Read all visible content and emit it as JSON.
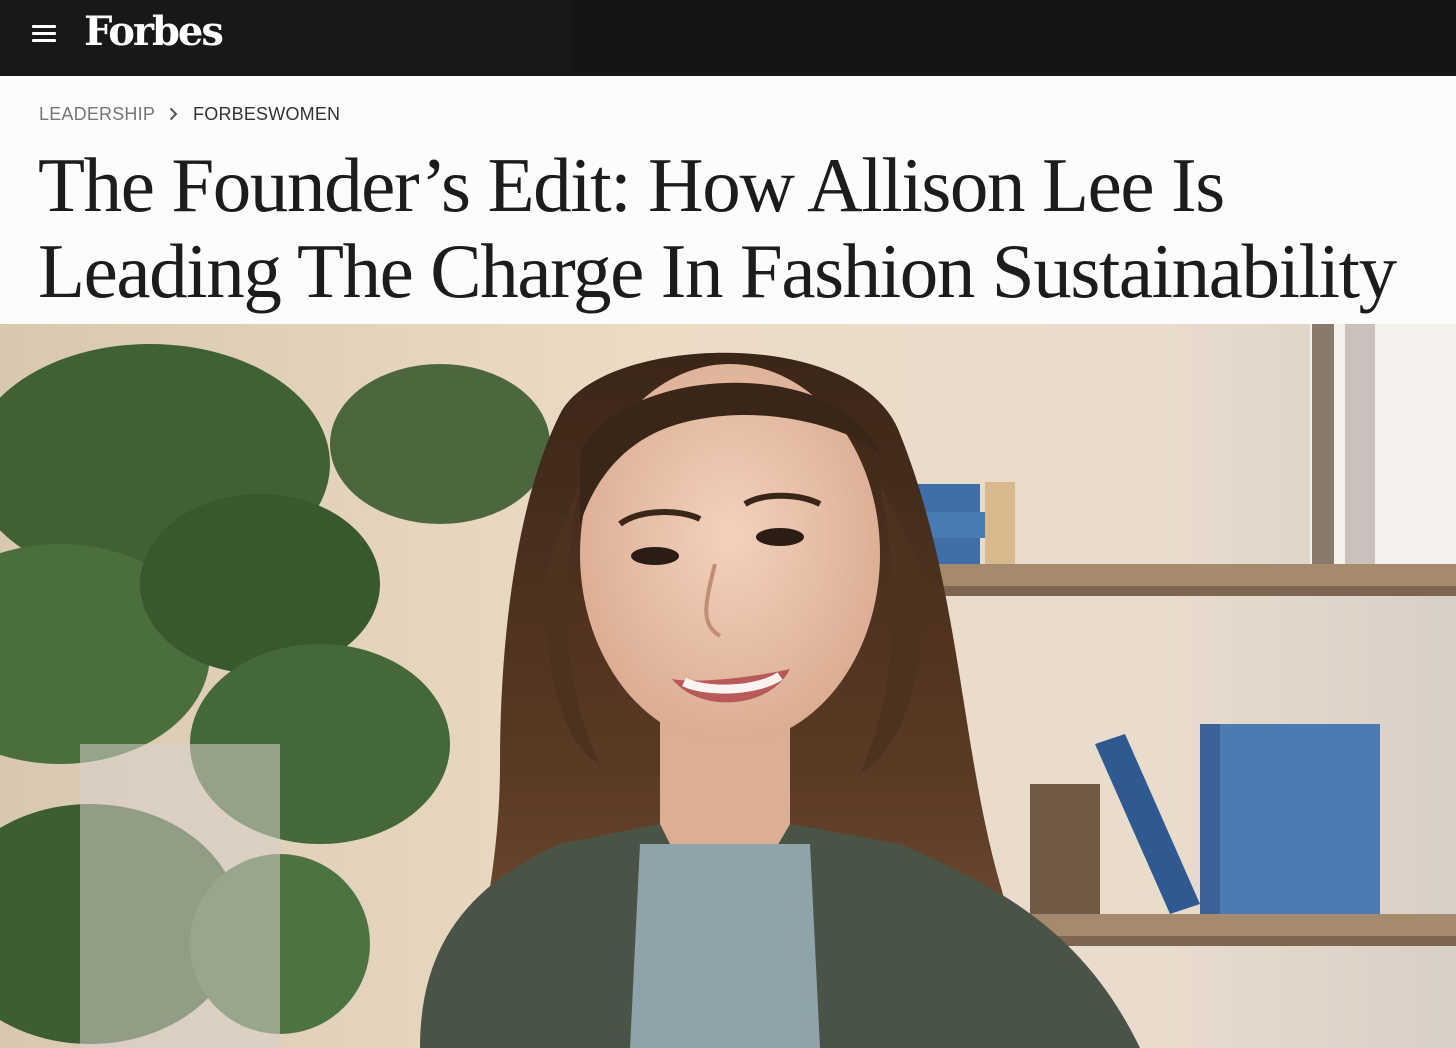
{
  "header": {
    "logo": "Forbes",
    "menu_icon": "hamburger-menu-icon"
  },
  "breadcrumb": {
    "section": "LEADERSHIP",
    "subsection": "FORBESWOMEN",
    "separator_icon": "chevron-right-icon"
  },
  "article": {
    "title_line1": "The Founder’s Edit: How Allison Lee Is",
    "title_line2": "Leading The Charge In Fashion Sustainability"
  },
  "colors": {
    "header_bg": "#181818",
    "page_bg": "#fcfcfc",
    "headline": "#1c1c1c",
    "breadcrumb_muted": "#767676"
  }
}
